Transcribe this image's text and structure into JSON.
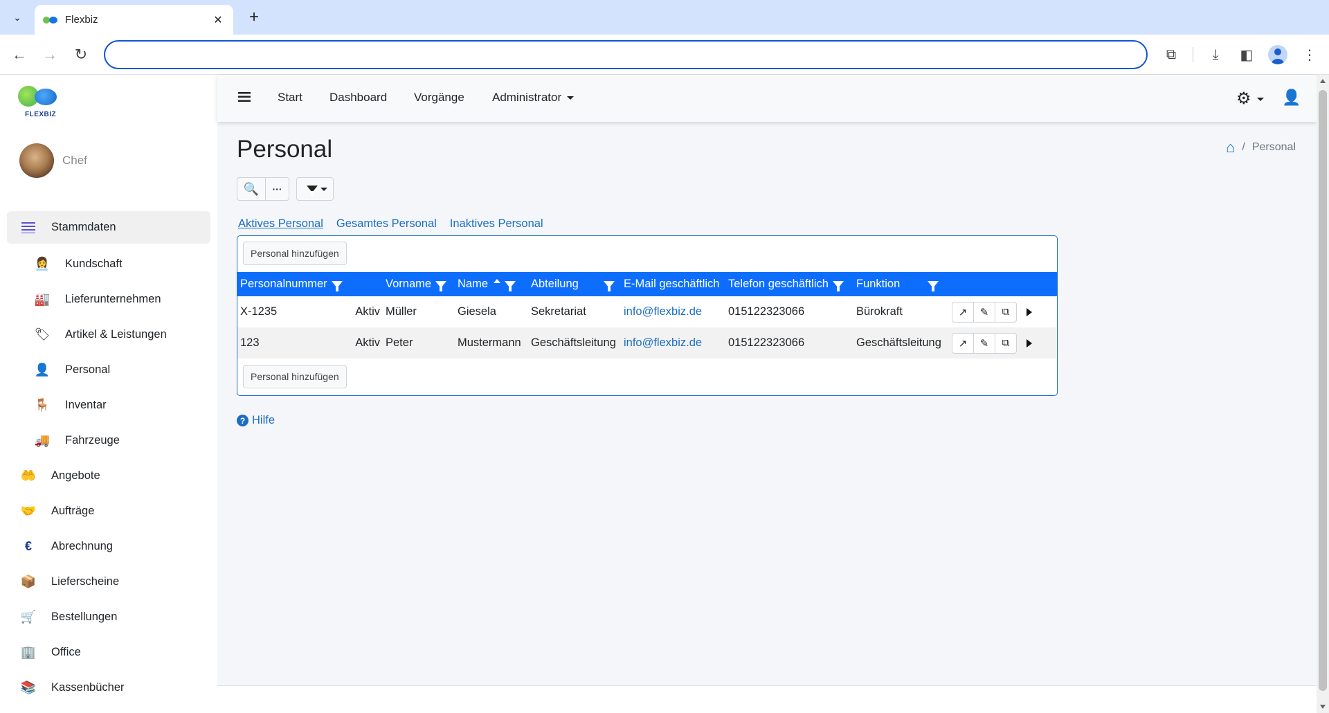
{
  "browser": {
    "tab_title": "Flexbiz",
    "tab_close": "✕",
    "new_tab": "+",
    "address": ""
  },
  "brand": {
    "logo_text": "FLEXBIZ",
    "colors": {
      "green": "#6cc24a",
      "blue": "#1b73e8"
    }
  },
  "user": {
    "name": "Chef"
  },
  "sidebar": {
    "items": [
      {
        "label": "Stammdaten",
        "icon": "list-icon",
        "level": "top",
        "active": true
      },
      {
        "label": "Kundschaft",
        "icon": "customer-icon",
        "level": "sub"
      },
      {
        "label": "Lieferunternehmen",
        "icon": "factory-icon",
        "level": "sub"
      },
      {
        "label": "Artikel & Leistungen",
        "icon": "price-tag-icon",
        "level": "sub"
      },
      {
        "label": "Personal",
        "icon": "person-icon",
        "level": "sub"
      },
      {
        "label": "Inventar",
        "icon": "chair-icon",
        "level": "sub"
      },
      {
        "label": "Fahrzeuge",
        "icon": "truck-icon",
        "level": "sub"
      },
      {
        "label": "Angebote",
        "icon": "hand-icon",
        "level": "top"
      },
      {
        "label": "Aufträge",
        "icon": "handshake-icon",
        "level": "top"
      },
      {
        "label": "Abrechnung",
        "icon": "euro-icon",
        "level": "top"
      },
      {
        "label": "Lieferscheine",
        "icon": "delivery-icon",
        "level": "top"
      },
      {
        "label": "Bestellungen",
        "icon": "cart-icon",
        "level": "top"
      },
      {
        "label": "Office",
        "icon": "office-icon",
        "level": "top"
      },
      {
        "label": "Kassenbücher",
        "icon": "cashbook-icon",
        "level": "top"
      }
    ]
  },
  "topnav": {
    "links": [
      "Start",
      "Dashboard",
      "Vorgänge"
    ],
    "admin": "Administrator"
  },
  "page": {
    "title": "Personal",
    "breadcrumb_current": "Personal",
    "breadcrumb_sep": "/"
  },
  "tabs": [
    "Aktives Personal",
    "Gesamtes Personal",
    "Inaktives Personal"
  ],
  "table": {
    "add_label": "Personal hinzufügen",
    "columns": [
      "Personalnummer",
      "Vorname",
      "Name",
      "Abteilung",
      "E-Mail geschäftlich",
      "Telefon geschäftlich",
      "Funktion"
    ],
    "rows": [
      {
        "nr": "X-1235",
        "status": "Aktiv",
        "vorname": "Müller",
        "name": "Giesela",
        "abteilung": "Sekretariat",
        "email": "info@flexbiz.de",
        "telefon": "015122323066",
        "funktion": "Bürokraft"
      },
      {
        "nr": "123",
        "status": "Aktiv",
        "vorname": "Peter",
        "name": "Mustermann",
        "abteilung": "Geschäftsleitung",
        "email": "info@flexbiz.de",
        "telefon": "015122323066",
        "funktion": "Geschäftsleitung"
      }
    ]
  },
  "help": {
    "label": "Hilfe"
  },
  "accent_color": "#0d6efd"
}
